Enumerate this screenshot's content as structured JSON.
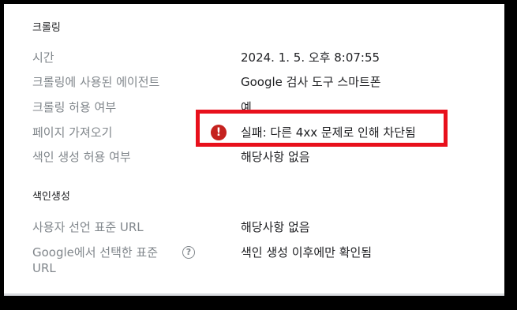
{
  "crawl_section": {
    "title": "크롤링",
    "rows": [
      {
        "label": "시간",
        "value": "2024. 1. 5. 오후 8:07:55"
      },
      {
        "label": "크롤링에 사용된 에이전트",
        "value": "Google 검사 도구 스마트폰"
      },
      {
        "label": "크롤링 허용 여부",
        "value": "예"
      },
      {
        "label": "페이지 가져오기",
        "value": "실패: 다른 4xx 문제로 인해 차단됨"
      },
      {
        "label": "색인 생성 허용 여부",
        "value": "해당사항 없음"
      }
    ]
  },
  "index_section": {
    "title": "색인생성",
    "rows": [
      {
        "label": "사용자 선언 표준 URL",
        "value": "해당사항 없음"
      },
      {
        "label_line1": "Google에서 선택한 표준",
        "label_line2": "URL",
        "value": "색인 생성 이후에만 확인됨"
      }
    ]
  },
  "icons": {
    "error": "error-icon",
    "help": "help-circle-icon"
  },
  "colors": {
    "error_icon": "#c5221f",
    "highlight_box": "#e8101c",
    "label_text": "#80868b",
    "value_text": "#202124"
  }
}
